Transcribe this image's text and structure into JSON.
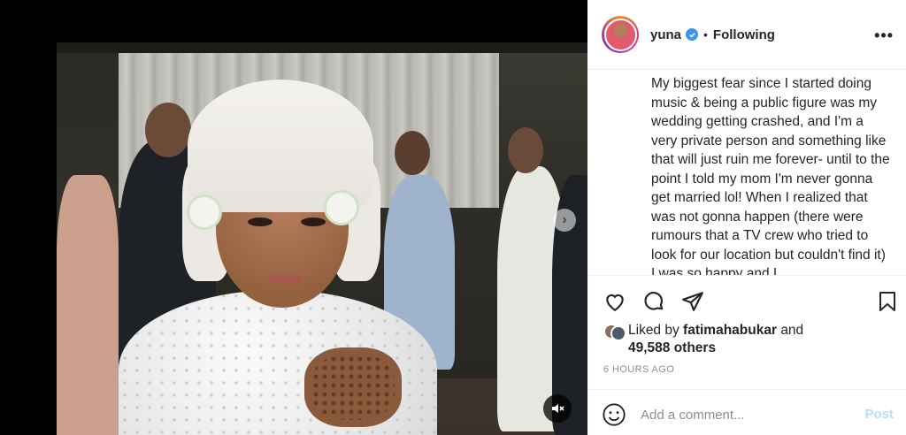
{
  "post": {
    "username": "yuna",
    "separator": "•",
    "follow_status": "Following",
    "more_label": "•••",
    "caption": "My biggest fear since I started doing music & being a public figure was my wedding getting crashed, and I'm a very private person and something like that will just ruin me forever- until to the point I told my mom I'm never gonna get married lol! When I realized that was not gonna happen (there were rumours that a TV crew who tried to look for our location but couldn't find it) I was so happy and I",
    "likes": {
      "prefix": "Liked by",
      "user": "fatimahabukar",
      "conjunction": "and",
      "others": "49,588 others"
    },
    "timestamp": "6 HOURS AGO"
  },
  "comment": {
    "placeholder": "Add a comment...",
    "post_label": "Post"
  },
  "media": {
    "next_arrow": "›"
  },
  "colors": {
    "verified": "#3897f0",
    "post_disabled": "#b2dffc",
    "text": "#262626",
    "muted": "#8e8e8e"
  },
  "icons": [
    "verified-badge-icon",
    "heart-icon",
    "comment-icon",
    "share-icon",
    "bookmark-icon",
    "emoji-icon",
    "mute-icon",
    "next-arrow-icon",
    "more-options-icon"
  ]
}
